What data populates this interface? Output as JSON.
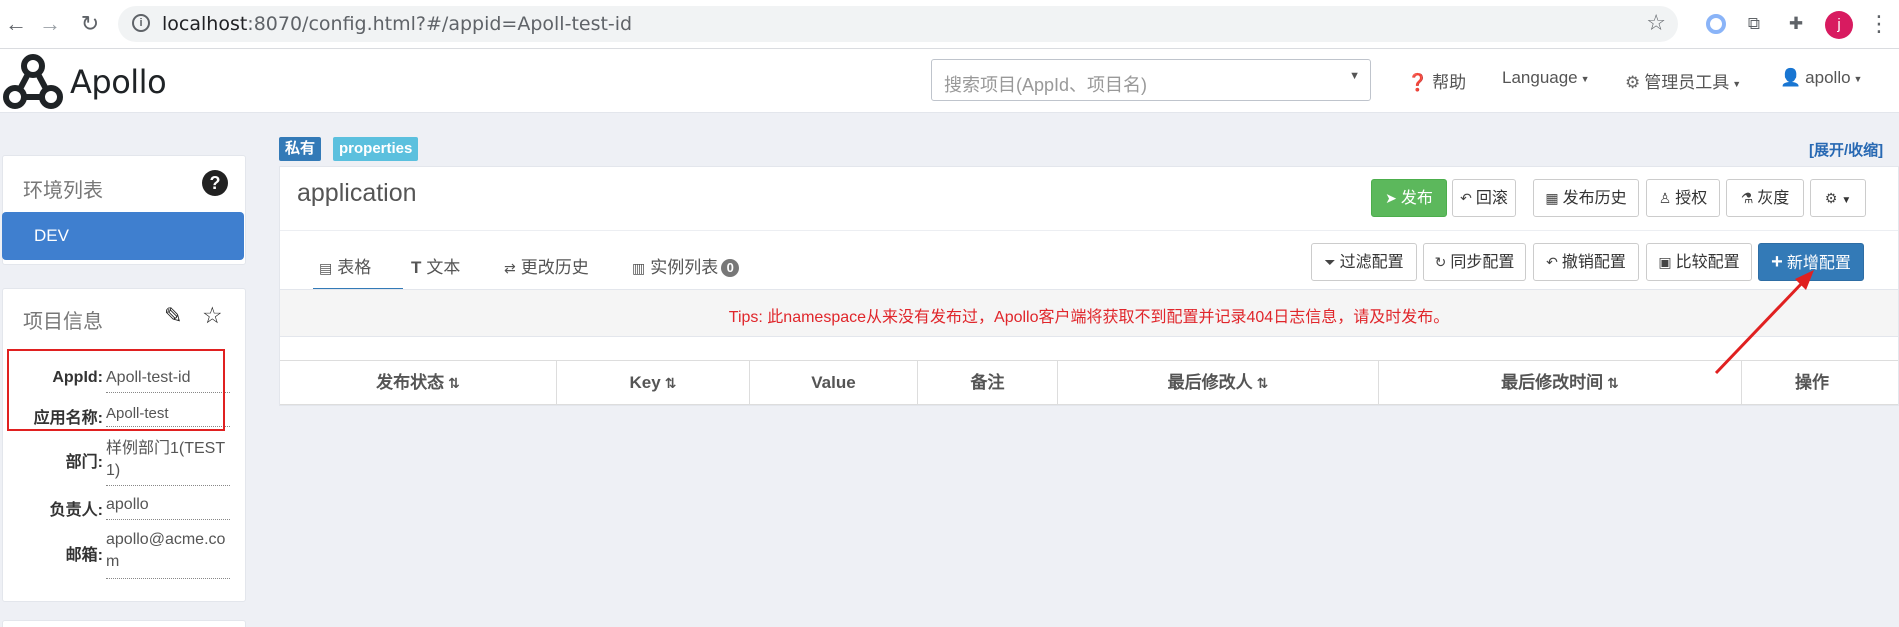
{
  "browser": {
    "back_icon": "back-arrow-icon",
    "forward_icon": "forward-arrow-icon",
    "reload_icon": "reload-icon",
    "url_host": "localhost",
    "url_rest": ":8070/config.html?#/appid=Apoll-test-id",
    "profile_initial": "j"
  },
  "navbar": {
    "logo_text": "Apollo",
    "search_placeholder": "搜索项目(AppId、项目名)",
    "help_label": "帮助",
    "language_label": "Language",
    "admin_tools_label": "管理员工具",
    "user_label": "apollo"
  },
  "sidebar": {
    "env_panel_title": "环境列表",
    "env_items": [
      "DEV"
    ],
    "project_panel_title": "项目信息",
    "project_info": [
      {
        "label": "AppId:",
        "value": "Apoll-test-id"
      },
      {
        "label": "应用名称:",
        "value": "Apoll-test"
      },
      {
        "label": "部门:",
        "value": "样例部门1(TEST1)"
      },
      {
        "label": "负责人:",
        "value": "apollo"
      },
      {
        "label": "邮箱:",
        "value": "apollo@acme.com"
      }
    ]
  },
  "namespace": {
    "tag_private": "私有",
    "tag_format": "properties",
    "expand_link": "[展开/收缩]",
    "title": "application",
    "actions": {
      "publish": "发布",
      "rollback": "回滚",
      "publish_history": "发布历史",
      "authorize": "授权",
      "gray": "灰度"
    },
    "tabs": [
      {
        "label": "表格"
      },
      {
        "label": "文本"
      },
      {
        "label": "更改历史"
      },
      {
        "label": "实例列表",
        "badge": "0"
      }
    ],
    "tools": {
      "filter": "过滤配置",
      "sync": "同步配置",
      "revoke": "撤销配置",
      "compare": "比较配置",
      "add": "新增配置"
    },
    "tips": "Tips: 此namespace从来没有发布过，Apollo客户端将获取不到配置并记录404日志信息，请及时发布。",
    "columns": [
      "发布状态",
      "Key",
      "Value",
      "备注",
      "最后修改人",
      "最后修改时间",
      "操作"
    ]
  },
  "colors": {
    "primary": "#337ab7",
    "success": "#5cb85c",
    "danger": "#e0262b",
    "tag_info": "#5bc0de",
    "annotation_red": "#e02020"
  }
}
